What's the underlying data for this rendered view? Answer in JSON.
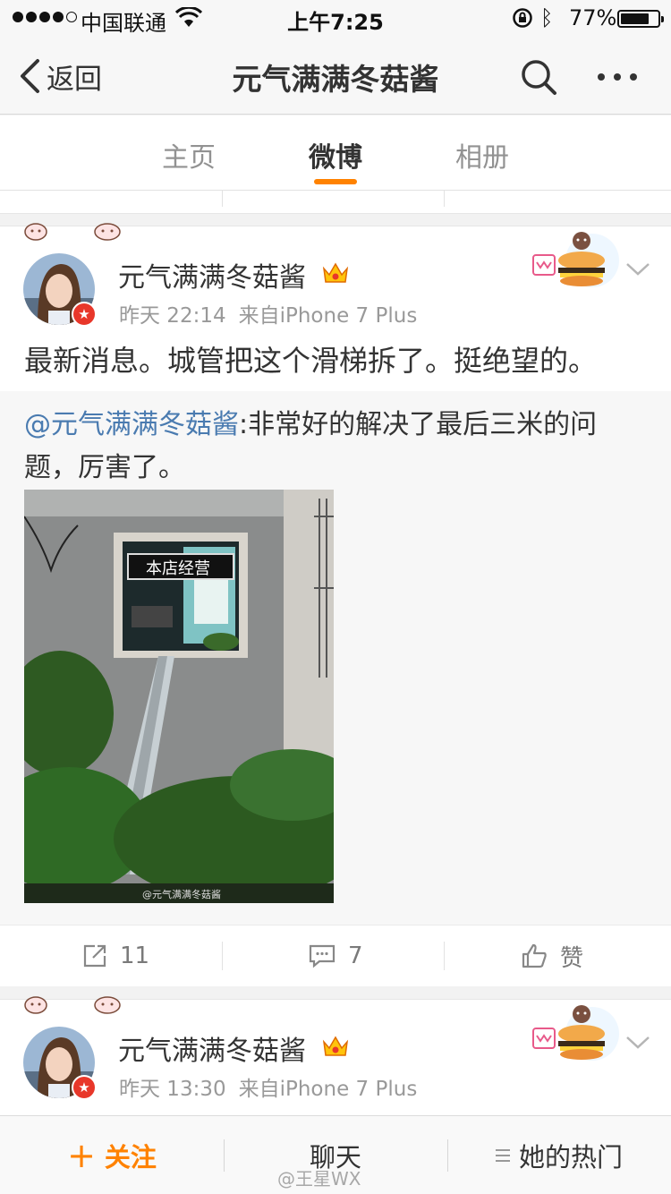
{
  "status_bar": {
    "carrier": "中国联通",
    "time": "上午7:25",
    "battery": "77%",
    "battery_level": 0.77
  },
  "nav": {
    "back_label": "返回",
    "title": "元气满满冬菇酱"
  },
  "tabs": [
    {
      "label": "主页",
      "active": false
    },
    {
      "label": "微博",
      "active": true
    },
    {
      "label": "相册",
      "active": false
    }
  ],
  "post1": {
    "username": "元气满满冬菇酱",
    "time": "昨天 22:14",
    "source": "来自iPhone 7 Plus",
    "text": "最新消息。城管把这个滑梯拆了。挺绝望的。",
    "repost": {
      "mention": "@元气满满冬菇酱",
      "text": ":非常好的解决了最后三米的问题，厉害了。",
      "image_sign": "本店经营",
      "image_watermark": "@元气满满冬菇酱"
    },
    "actions": {
      "repost_count": "11",
      "comment_count": "7",
      "like_label": "赞"
    }
  },
  "post2": {
    "username": "元气满满冬菇酱",
    "time": "昨天 13:30",
    "source": "来自iPhone 7 Plus"
  },
  "bottom_bar": {
    "follow": "关注",
    "chat": "聊天",
    "hot": "她的热门"
  },
  "watermark": "@王星WX",
  "colors": {
    "accent": "#ff8200",
    "link": "#4a7bb0",
    "vip": "#e8372a"
  }
}
